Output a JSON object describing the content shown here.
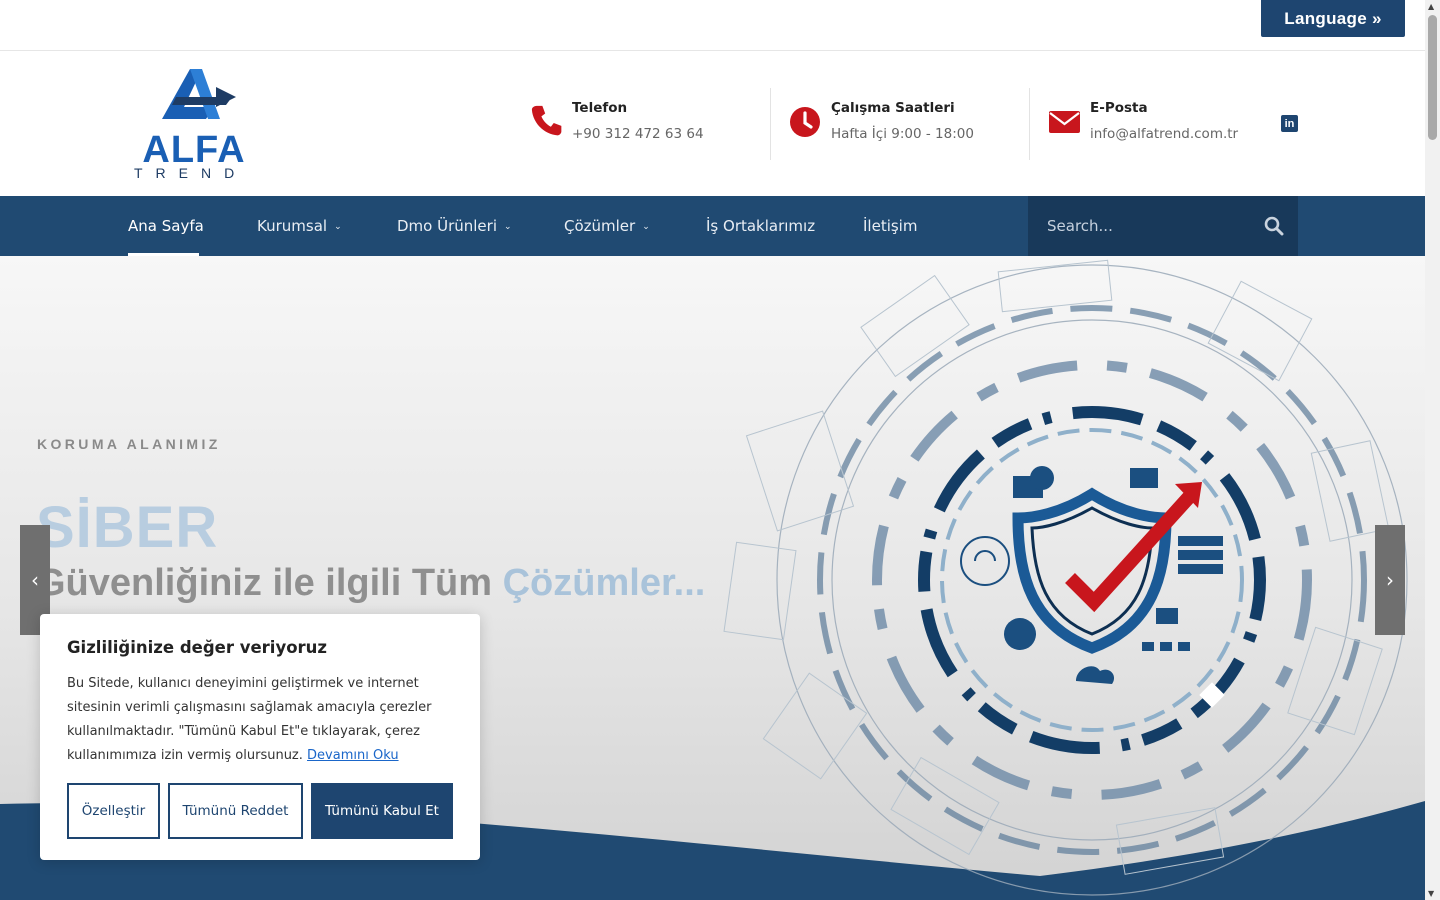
{
  "topbar": {
    "language_label": "Language »"
  },
  "header": {
    "logo_word": "ALFA",
    "logo_sub": "TREND",
    "phone": {
      "label": "Telefon",
      "value": "+90 312 472 63 64"
    },
    "hours": {
      "label": "Çalışma Saatleri",
      "value": "Hafta İçi 9:00 - 18:00"
    },
    "email": {
      "label": "E-Posta",
      "value": "info@alfatrend.com.tr"
    },
    "linkedin": "in"
  },
  "nav": {
    "items": [
      {
        "label": "Ana Sayfa"
      },
      {
        "label": "Kurumsal"
      },
      {
        "label": "Dmo Ürünleri"
      },
      {
        "label": "Çözümler"
      },
      {
        "label": "İş Ortaklarımız"
      },
      {
        "label": "İletişim"
      }
    ],
    "search_placeholder": "Search..."
  },
  "hero": {
    "kicker": "KORUMA ALANIMIZ",
    "big": "SİBER",
    "line_main": "Güvenliğiniz ile ilgili Tüm ",
    "line_accent": "Çözümler...",
    "prev": "‹",
    "next": "›"
  },
  "cookie": {
    "title": "Gizliliğinize değer veriyoruz",
    "text": "Bu Sitede, kullanıcı deneyimini geliştirmek ve internet sitesinin verimli çalışmasını sağlamak amacıyla çerezler kullanılmaktadır. \"Tümünü Kabul Et\"e tıklayarak, çerez kullanımımıza izin vermiş olursunuz.",
    "read_more": "Devamını Oku",
    "customize": "Özelleştir",
    "reject": "Tümünü Reddet",
    "accept": "Tümünü Kabul Et"
  },
  "colors": {
    "primary": "#1e4570",
    "nav": "#204a72",
    "accent_red": "#c8161d"
  }
}
